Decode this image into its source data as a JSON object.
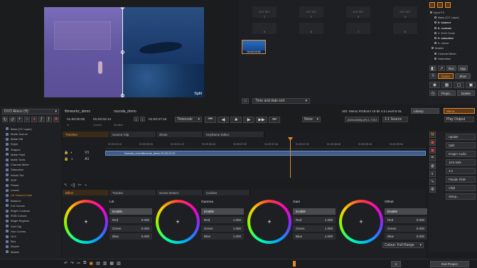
{
  "viewer": {
    "split_label": "Split"
  },
  "gallery": {
    "slots": [
      {
        "label": "NOT SET",
        "num": "1"
      },
      {
        "label": "NOT SET",
        "num": "2"
      },
      {
        "label": "NOT SET",
        "num": "3"
      },
      {
        "label": "NOT SET",
        "num": "4"
      },
      {
        "label": "",
        "num": "5"
      },
      {
        "label": "",
        "num": "6"
      },
      {
        "label": "",
        "num": "7"
      },
      {
        "label": "",
        "num": "8"
      }
    ],
    "thumb_tc": "01:00:13:15",
    "sort": "Time and date sort"
  },
  "layers": {
    "items": [
      "Input FX",
      "Base (CC Layer)",
      "ft. balance",
      "ft. contrast",
      "3. DVO Grain",
      "ft. saturation",
      "ft. colour",
      "Master",
      "Channel Mixer",
      "Saturation"
    ],
    "tabs": {
      "rec": "Rec",
      "app": "App",
      "notes": "Notes",
      "shot": "Shot",
      "props": "Props...",
      "delete": "Delete"
    }
  },
  "header": {
    "project": "filmworkz_demo",
    "clip": "nucoda_demo",
    "format": "SDI: Memo RGB444 10-bit 4:3 Level B-DL",
    "library": "Library",
    "menu": "Menu..."
  },
  "transport": {
    "tc_in": "01:00:00:00",
    "tc_cur": "01:02:02:14",
    "tc_out": "01:00:37:15",
    "mode": "Timecode",
    "none": "None",
    "res": "1920x1080p (H) 1.778 Fit",
    "scale": "1:1 Source",
    "output": "Play Output",
    "labels": {
      "in": "In",
      "cur": "Current",
      "dur": "Duration"
    }
  },
  "left": {
    "preset": "DVO Aliens (H)",
    "effects": [
      "Base (CC Layer)",
      "Matte Source",
      "Matte Diff",
      "Keyer",
      "Shapes",
      "Matte Paint",
      "Matte Tools",
      "Channel Mixer",
      "Saturation",
      "Kelvin Tint",
      "SOP",
      "Printer",
      "Levels",
      "Lift Gamma Gain",
      "Balance",
      "Col Curves",
      "Bright Contrast",
      "RGB Curves",
      "Bright Regions",
      "Soft Clip",
      "Hue Curves",
      "HLS",
      "Blur",
      "Router",
      "Master"
    ]
  },
  "timeline": {
    "tabs": [
      "Timeline",
      "Source Clip",
      "Shots",
      "Keyframe Editor"
    ],
    "ticks": [
      "01:00:24:10",
      "01:00:30:20",
      "01:00:31:10",
      "01:00:36:16",
      "01:00:37:02",
      "01:00:37:16",
      "01:00:37:22",
      "01:00:38:08",
      "01:00:39:15",
      "01:00:39:04"
    ],
    "tracks": [
      "V1",
      "A1"
    ],
    "clip_label": "Nucoda_reveri|Nucoda_demo  00:00:12:22"
  },
  "grade": {
    "tabs": [
      "Effect",
      "Tracker",
      "Scene Detect",
      "Caches"
    ],
    "sections": [
      {
        "title": "Lift",
        "enable": "Enable",
        "rows": [
          {
            "k": "Red",
            "v": "0.000"
          },
          {
            "k": "Green",
            "v": "0.000"
          },
          {
            "k": "Blue",
            "v": "0.000"
          }
        ]
      },
      {
        "title": "Gamma",
        "enable": "Enable",
        "rows": [
          {
            "k": "Red",
            "v": "1.000"
          },
          {
            "k": "Green",
            "v": "1.000"
          },
          {
            "k": "Blue",
            "v": "1.000"
          }
        ]
      },
      {
        "title": "Gain",
        "enable": "Enable",
        "rows": [
          {
            "k": "Red",
            "v": "1.000"
          },
          {
            "k": "Green",
            "v": "1.000"
          },
          {
            "k": "Blue",
            "v": "1.000"
          }
        ]
      },
      {
        "title": "Offset",
        "enable": "Enable",
        "rows": [
          {
            "k": "Red",
            "v": "0.000"
          },
          {
            "k": "Green",
            "v": "0.000"
          },
          {
            "k": "Blue",
            "v": "0.000"
          }
        ]
      }
    ],
    "colour_range": "Colour: Full Range"
  },
  "right": {
    "update": "Update",
    "split": "Split",
    "image_audio": "Image+Audio",
    "safe": "16:9 Safe",
    "ratio": "4:3",
    "parade": "Parade RGB",
    "vifull": "Vifull",
    "setup": "Setup..."
  },
  "footer": {
    "exit": "Exit Project",
    "num": "1"
  },
  "colors": {
    "accent": "#e08a2c",
    "viewer_left": "#6a5fa8",
    "water": "#1c3d6e"
  }
}
